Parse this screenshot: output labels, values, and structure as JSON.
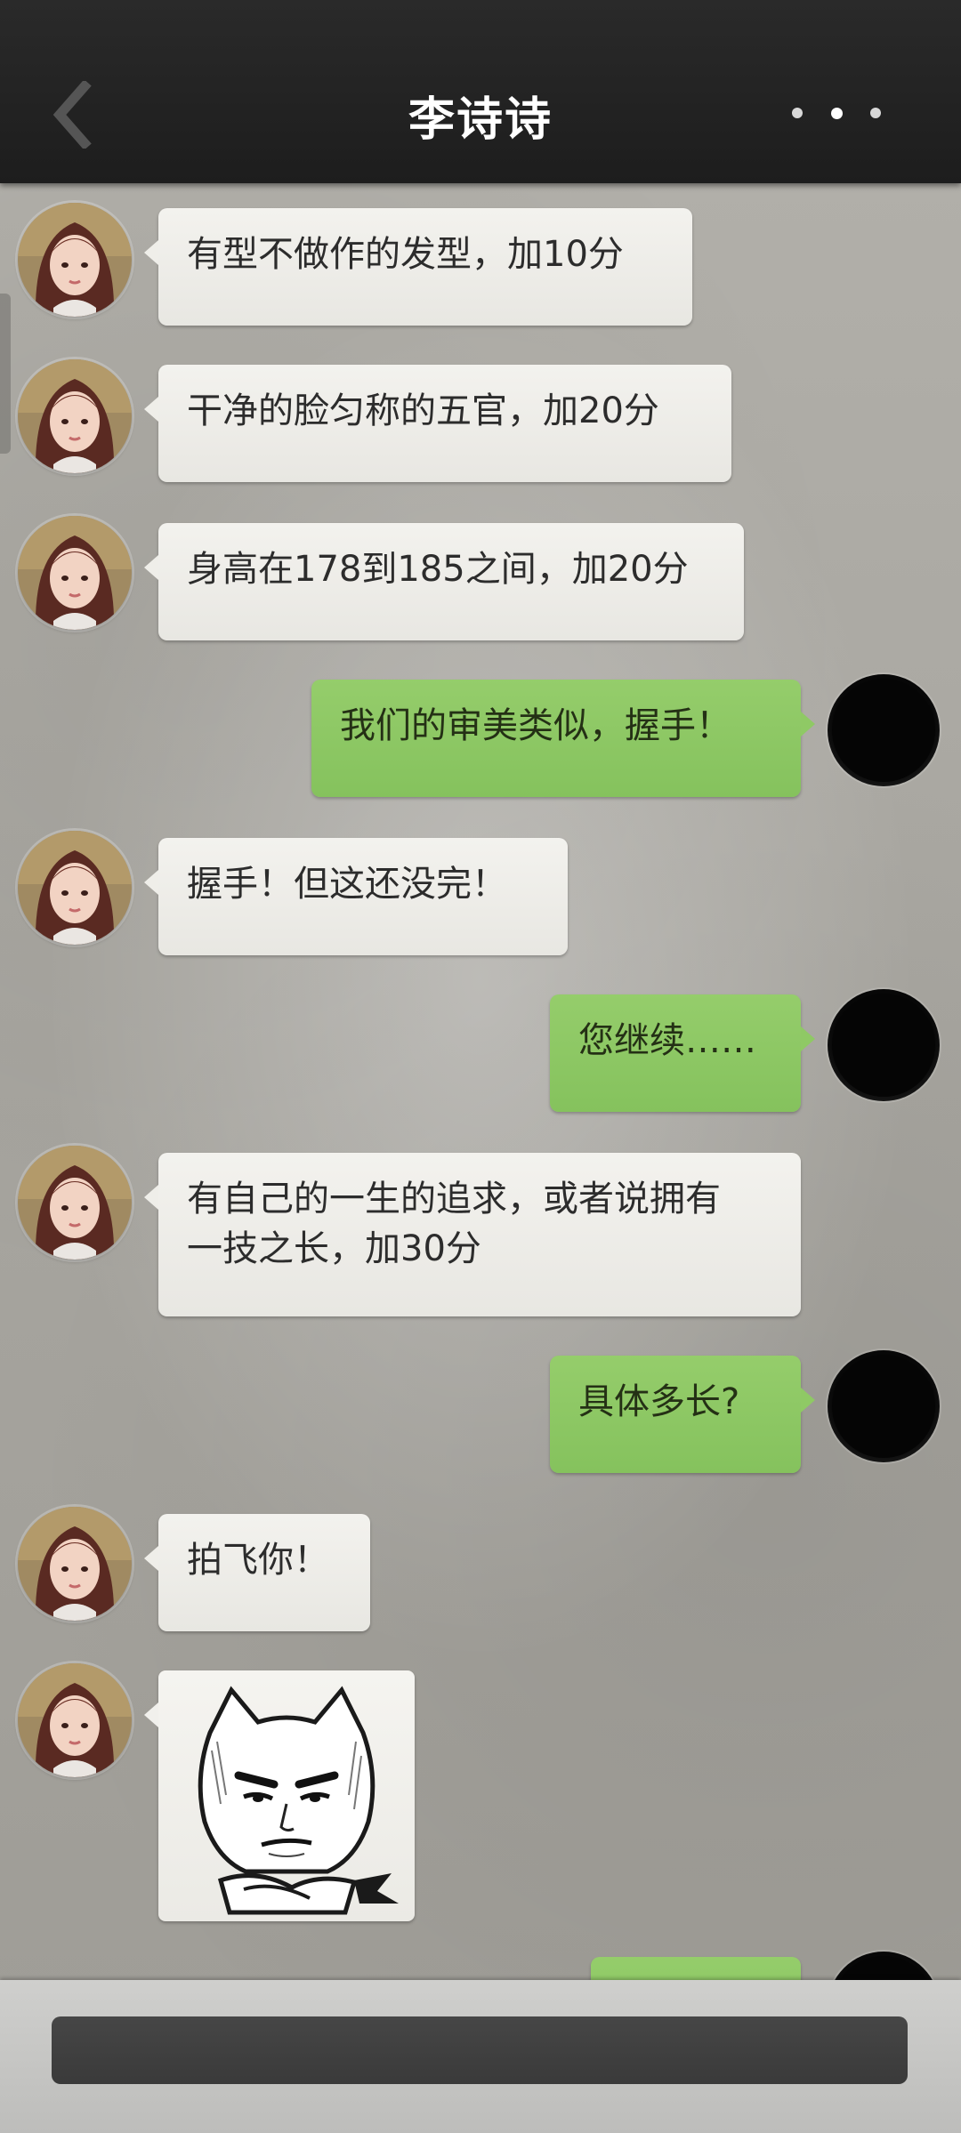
{
  "header": {
    "title": "李诗诗",
    "back_icon": "chevron-left-icon",
    "more_icon": "more-dots-icon"
  },
  "contact": {
    "avatar_icon": "female-avatar",
    "my_avatar_icon": "dark-avatar"
  },
  "messages": [
    {
      "side": "left",
      "text": "有型不做作的发型，加10分"
    },
    {
      "side": "left",
      "text": "干净的脸匀称的五官，加20分"
    },
    {
      "side": "left",
      "text": "身高在178到185之间，加20分"
    },
    {
      "side": "right",
      "text": "我们的审美类似，握手！"
    },
    {
      "side": "left",
      "text": "握手！但这还没完！"
    },
    {
      "side": "right",
      "text": "您继续……"
    },
    {
      "side": "left",
      "text": "有自己的一生的追求，或者说拥有\n一技之长，加30分"
    },
    {
      "side": "right",
      "text": "具体多长?"
    },
    {
      "side": "left",
      "text": "拍飞你！"
    },
    {
      "side": "left",
      "type": "sticker",
      "sticker": "smug-cat-meme-sticker"
    },
    {
      "side": "right",
      "text": ""
    }
  ],
  "input": {
    "value": "",
    "placeholder": ""
  },
  "colors": {
    "header_bg": "#1f1f1f",
    "left_bubble": "#efeee9",
    "right_bubble": "#8ec864",
    "input_bar": "#c8c8c6",
    "input_field": "#404040"
  }
}
